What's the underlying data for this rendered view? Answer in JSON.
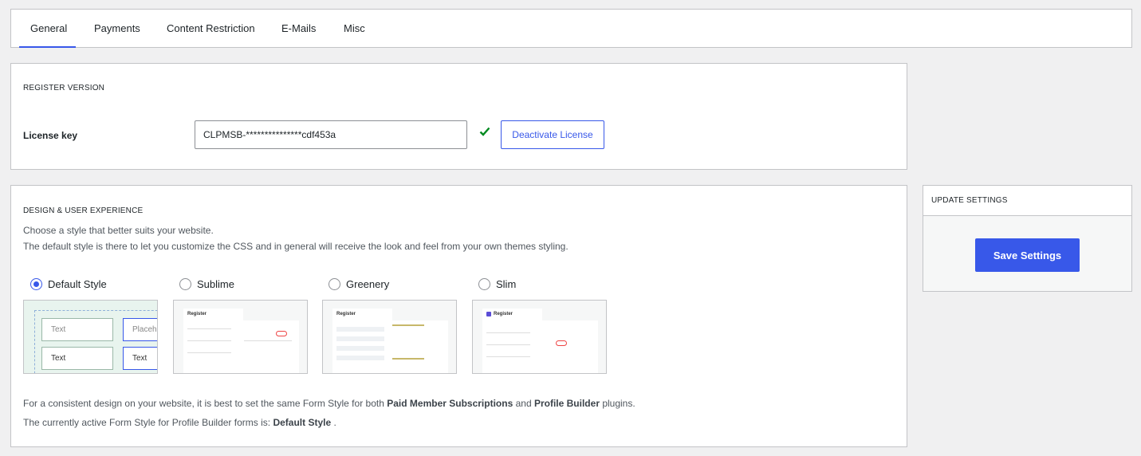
{
  "tabs": [
    "General",
    "Payments",
    "Content Restriction",
    "E-Mails",
    "Misc"
  ],
  "register": {
    "title": "REGISTER VERSION",
    "license_label": "License key",
    "license_value": "CLPMSB-***************cdf453a",
    "deactivate_label": "Deactivate License"
  },
  "design": {
    "title": "DESIGN & USER EXPERIENCE",
    "desc1": "Choose a style that better suits your website.",
    "desc2": "The default style is there to let you customize the CSS and in general will receive the look and feel from your own themes styling.",
    "styles": [
      {
        "label": "Default Style",
        "checked": true
      },
      {
        "label": "Sublime",
        "checked": false
      },
      {
        "label": "Greenery",
        "checked": false
      },
      {
        "label": "Slim",
        "checked": false
      }
    ],
    "preview_default": {
      "field1": "Text",
      "field2": "Placeho",
      "field3": "Text",
      "field4": "Text"
    },
    "preview_sublime_title": "Register",
    "preview_greenery_title": "Register",
    "preview_slim_title": "Register",
    "note1_a": "For a consistent design on your website, it is best to set the same Form Style for both ",
    "note1_b": "Paid Member Subscriptions",
    "note1_c": " and ",
    "note1_d": "Profile Builder",
    "note1_e": " plugins.",
    "note2_a": "The currently active Form Style for Profile Builder forms is: ",
    "note2_b": "Default Style",
    "note2_c": " ."
  },
  "update": {
    "title": "UPDATE SETTINGS",
    "save_label": "Save Settings"
  },
  "colors": {
    "accent": "#3858e9",
    "check": "#008a20"
  }
}
